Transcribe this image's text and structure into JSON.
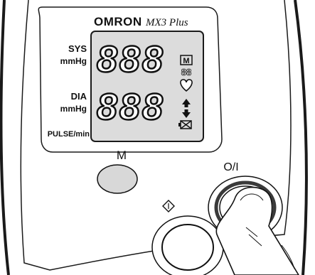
{
  "brand": {
    "logo_text": "OMRON",
    "model": "MX3 Plus"
  },
  "display": {
    "sys_label": "SYS",
    "sys_unit": "mmHg",
    "dia_label": "DIA",
    "dia_unit": "mmHg",
    "pulse_label": "PULSE/min",
    "sys_digits": "888",
    "dia_digits": "888",
    "memory_symbol": "M",
    "memory_digits": "88",
    "icons": [
      "memory-icon",
      "heart-icon",
      "inflate-up-arrow-icon",
      "deflate-down-arrow-icon",
      "battery-icon"
    ]
  },
  "buttons": {
    "memory_label": "M",
    "power_label": "O/I",
    "start_symbol": "◊"
  },
  "colors": {
    "lcd": "#dcdcdc",
    "body": "#ffffff",
    "outline": "#1a1a1a",
    "memory_button": "#d8d8d8",
    "power_ring": "#3a3a3a"
  }
}
